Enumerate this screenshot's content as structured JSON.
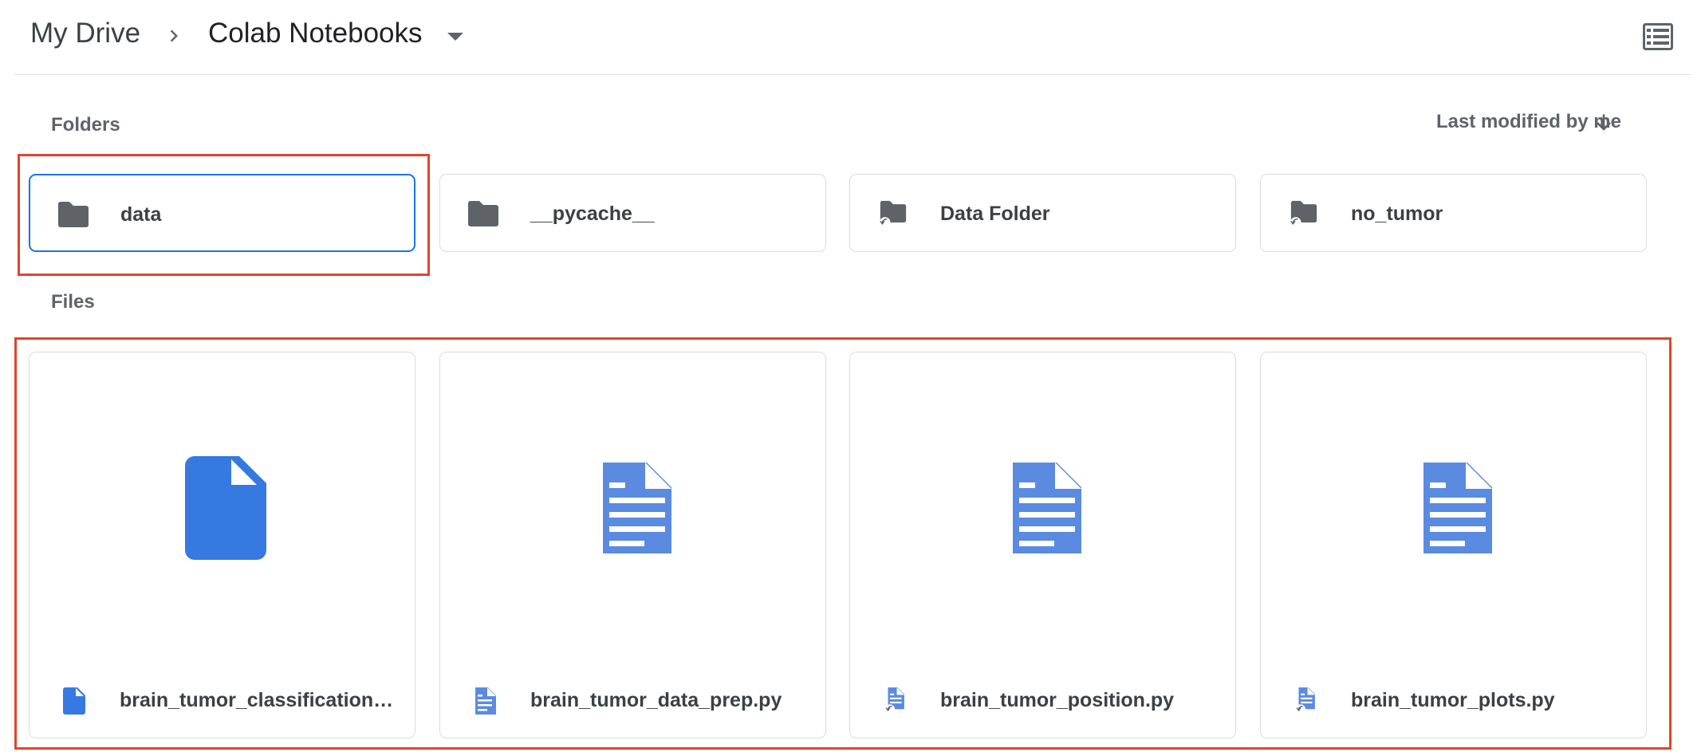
{
  "breadcrumb": {
    "root": "My Drive",
    "current": "Colab Notebooks"
  },
  "icons": {
    "separator": "chevron-right-icon",
    "dropdown": "arrow-drop-down-icon",
    "view_toggle": "list-view-icon",
    "sort_direction": "arrow-downward-icon"
  },
  "sections": {
    "folders_label": "Folders",
    "files_label": "Files"
  },
  "sort": {
    "label": "Last modified by me"
  },
  "folders": [
    {
      "name": "data",
      "icon": "folder-icon",
      "selected": true
    },
    {
      "name": "__pycache__",
      "icon": "folder-icon"
    },
    {
      "name": "Data Folder",
      "icon": "shared-folder-icon"
    },
    {
      "name": "no_tumor",
      "icon": "shared-folder-icon"
    }
  ],
  "files": [
    {
      "name": "brain_tumor_classification.i…",
      "icon": "file-icon"
    },
    {
      "name": "brain_tumor_data_prep.py",
      "icon": "document-icon"
    },
    {
      "name": "brain_tumor_position.py",
      "icon": "shortcut-document-icon"
    },
    {
      "name": "brain_tumor_plots.py",
      "icon": "shortcut-document-icon"
    }
  ],
  "colors": {
    "accent": "#1a73e8",
    "folder_icon": "#5f6368",
    "file_icon": "#3579e1",
    "doc_icon": "#5a8be0",
    "highlight": "#e0452b",
    "border": "#dadce0"
  }
}
